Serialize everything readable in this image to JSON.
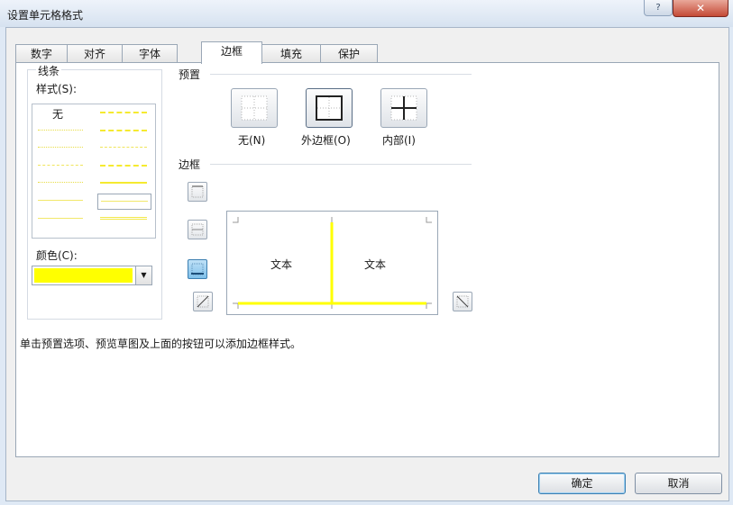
{
  "window": {
    "title": "设置单元格格式",
    "help_glyph": "?",
    "close_glyph": "✕"
  },
  "tabs": [
    {
      "label": "数字"
    },
    {
      "label": "对齐"
    },
    {
      "label": "字体"
    },
    {
      "label": "边框",
      "active": true
    },
    {
      "label": "填充"
    },
    {
      "label": "保护"
    }
  ],
  "line": {
    "group_label": "线条",
    "style_label": "样式(S):",
    "none_label": "无",
    "color_label": "颜色(C):",
    "color_value": "#ffff00",
    "dropdown_glyph": "▼"
  },
  "presets": {
    "section_label": "预置",
    "items": [
      {
        "label": "无(N)"
      },
      {
        "label": "外边框(O)"
      },
      {
        "label": "内部(I)"
      }
    ]
  },
  "border": {
    "section_label": "边框",
    "preview_text_left": "文本",
    "preview_text_right": "文本",
    "border_color": "#ffff00"
  },
  "hint": "单击预置选项、预览草图及上面的按钮可以添加边框样式。",
  "buttons": {
    "ok": "确定",
    "cancel": "取消"
  }
}
